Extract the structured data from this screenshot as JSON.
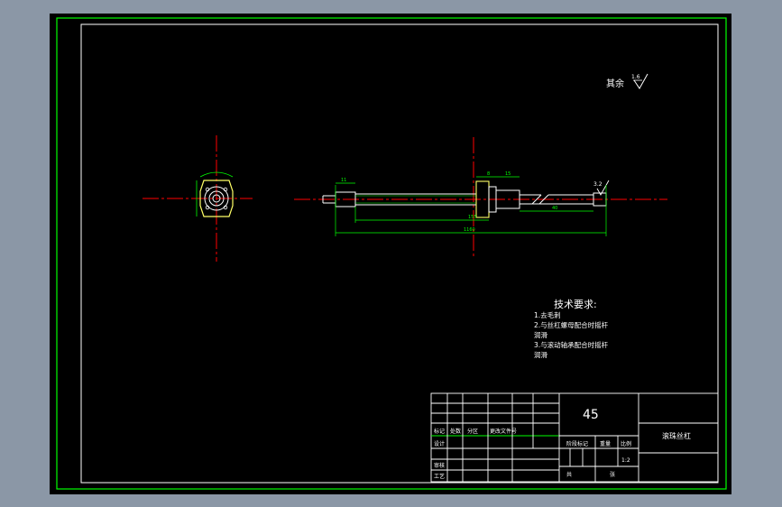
{
  "roughness_note": {
    "label": "其余",
    "value": "1.6"
  },
  "roughness_end": {
    "value": "3.2"
  },
  "tech_requirements": {
    "title": "技术要求:",
    "items": [
      "1.去毛刺",
      "2.与丝杠螺母配合时摇杆",
      "润滑",
      "3.与滚动轴承配合时摇杆",
      "润滑"
    ]
  },
  "title_block": {
    "material": "45",
    "part_name": "滚珠丝杠",
    "scale": "1:2",
    "row_labels": [
      "标记",
      "处数",
      "分区",
      "更改文件号"
    ],
    "design_label": "设计",
    "review_label": "审核",
    "craft_label": "工艺",
    "stage_label": "阶段标记",
    "weight_label": "重量",
    "scale_label": "比例",
    "sheet_label": "共",
    "sheet_of_label": "张"
  },
  "dimensions": {
    "left_end": "11",
    "total_length": "1160",
    "mid": "155",
    "flange_w": "8",
    "collar": "15",
    "right_len": "40"
  },
  "colors": {
    "background": "#8b97a6",
    "paper": "#000000",
    "border": "#00ff00",
    "center_line": "#ff0000",
    "outline": "#ffffff",
    "dimension": "#00ff00",
    "text": "#ffffff"
  }
}
